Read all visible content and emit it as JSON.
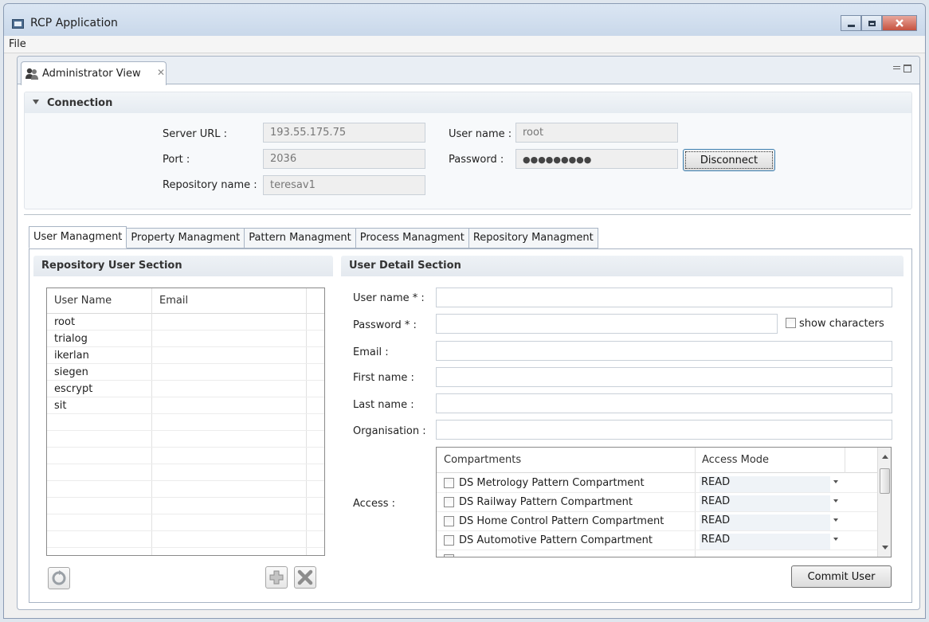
{
  "window": {
    "title": "RCP Application"
  },
  "menubar": {
    "file": "File"
  },
  "view": {
    "tab_label": "Administrator View",
    "close_glyph": "✕"
  },
  "connection": {
    "title": "Connection",
    "server_url_label": "Server URL :",
    "server_url_value": "193.55.175.75",
    "port_label": "Port :",
    "port_value": "2036",
    "repository_name_label": "Repository name :",
    "repository_name_value": "teresav1",
    "user_name_label": "User name :",
    "user_name_value": "root",
    "password_label": "Password :",
    "password_value": "●●●●●●●●●",
    "disconnect_label": "Disconnect"
  },
  "tabs": [
    {
      "label": "User Managment",
      "active": true
    },
    {
      "label": "Property Managment",
      "active": false
    },
    {
      "label": "Pattern Managment",
      "active": false
    },
    {
      "label": "Process Managment",
      "active": false
    },
    {
      "label": "Repository Managment",
      "active": false
    }
  ],
  "repository_user_section": {
    "title": "Repository User Section",
    "columns": [
      "User Name",
      "Email"
    ],
    "users": [
      "root",
      "trialog",
      "ikerlan",
      "siegen",
      "escrypt",
      "sit"
    ],
    "icons": {
      "refresh": "refresh-icon",
      "add": "add-icon",
      "delete": "delete-icon"
    }
  },
  "user_detail_section": {
    "title": "User Detail Section",
    "user_name_label": "User name * :",
    "password_label": "Password * :",
    "show_characters_label": "show characters",
    "email_label": "Email :",
    "first_name_label": "First name :",
    "last_name_label": "Last name :",
    "organisation_label": "Organisation :",
    "access_label": "Access :",
    "access_columns": [
      "Compartments",
      "Access Mode"
    ],
    "access_rows": [
      {
        "compartment": "DS Metrology Pattern Compartment",
        "mode": "READ"
      },
      {
        "compartment": "DS Railway Pattern Compartment",
        "mode": "READ"
      },
      {
        "compartment": "DS Home Control Pattern Compartment",
        "mode": "READ"
      },
      {
        "compartment": "DS Automotive Pattern Compartment",
        "mode": "READ"
      }
    ],
    "commit_label": "Commit User"
  },
  "colors": {
    "accent": "#3c7fb1",
    "title_bar": "#c9d8ea",
    "close_button": "#c6523f"
  }
}
